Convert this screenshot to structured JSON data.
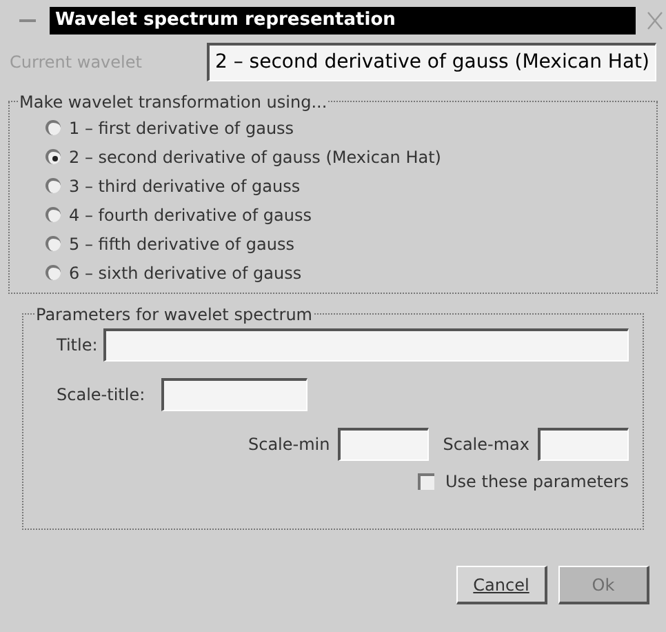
{
  "window": {
    "title": "Wavelet spectrum representation"
  },
  "current_wavelet": {
    "label": "Current wavelet",
    "disabled": true,
    "value": "2 – second derivative of gauss (Mexican Hat)"
  },
  "transformation": {
    "legend": "Make wavelet transformation using...",
    "options": [
      {
        "label": "1 – first derivative of gauss",
        "selected": false
      },
      {
        "label": "2 – second derivative of gauss (Mexican Hat)",
        "selected": true
      },
      {
        "label": "3 – third derivative of gauss",
        "selected": false
      },
      {
        "label": "4 – fourth derivative of gauss",
        "selected": false
      },
      {
        "label": "5 – fifth derivative of gauss",
        "selected": false
      },
      {
        "label": "6 – sixth derivative of gauss",
        "selected": false
      }
    ]
  },
  "parameters": {
    "legend": "Parameters for wavelet spectrum",
    "title_label": "Title:",
    "scale_title_label": "Scale-title:",
    "scale_min_label": "Scale-min",
    "scale_max_label": "Scale-max",
    "use_parameters": {
      "label": "Use these parameters",
      "checked": false
    }
  },
  "buttons": [
    {
      "label": "Cancel",
      "disabled": false
    },
    {
      "label": "Ok",
      "disabled": true
    }
  ]
}
